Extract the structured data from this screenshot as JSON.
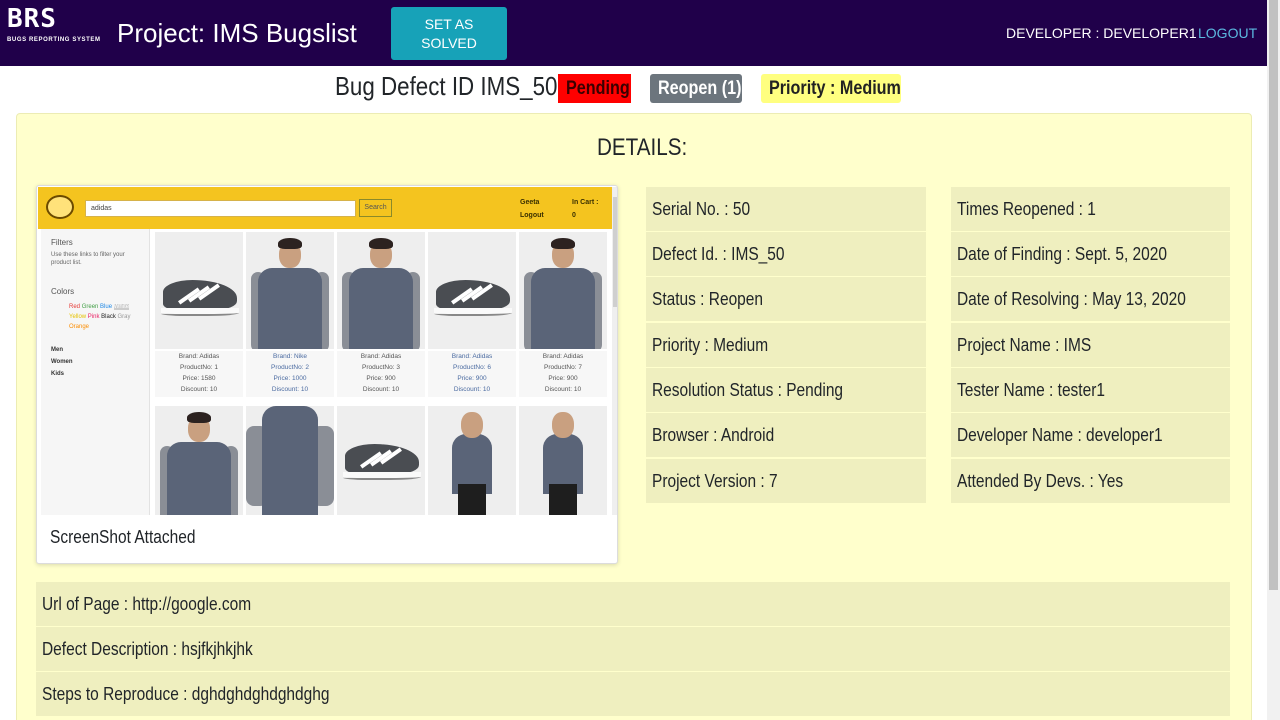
{
  "header": {
    "brand": "BRS",
    "brand_sub": "BUGS REPORTING SYSTEM",
    "project_title": "Project: IMS Bugslist",
    "solve_button": "SET AS SOLVED",
    "developer_label": "DEVELOPER : DEVELOPER1",
    "logout": "LOGOUT"
  },
  "bug": {
    "title": "Bug Defect ID IMS_50",
    "badge_status": "Pending",
    "badge_reopen": "Reopen (1)",
    "badge_priority": "Priority : Medium"
  },
  "details": {
    "heading": "DETAILS:",
    "screenshot_caption": "ScreenShot Attached",
    "left_fields": [
      "Serial No. : 50",
      "Defect Id. : IMS_50",
      "Status : Reopen",
      "Priority : Medium",
      "Resolution Status : Pending",
      "Browser : Android",
      "Project Version : 7"
    ],
    "right_fields": [
      "Times Reopened : 1",
      "Date of Finding : Sept. 5, 2020",
      "Date of Resolving : May 13, 2020",
      "Project Name : IMS",
      "Tester Name : tester1",
      "Developer Name : developer1",
      "Attended By Devs. : Yes"
    ],
    "full_fields": [
      "Url of Page : http://google.com",
      "Defect Description : hsjfkjhkjhk",
      "Steps to Reproduce : dghdghdghdghdghg"
    ]
  },
  "screenshot": {
    "search_value": "adidas",
    "search_button": "Search",
    "user_name": "Geeta",
    "user_logout": "Logout",
    "cart_label": "In Cart :",
    "cart_count": "0",
    "filters_title": "Filters",
    "filters_hint": "Use these links to filter your product list.",
    "colors_title": "Colors",
    "colors": [
      "Red",
      "Green",
      "Blue",
      "White",
      "Yellow",
      "Pink",
      "Black",
      "Gray",
      "Orange"
    ],
    "categories": [
      "Men",
      "Women",
      "Kids"
    ],
    "products": [
      {
        "brand": "Brand: Adidas",
        "product": "ProductNo: 1",
        "price": "Price: 1580",
        "discount": "Discount: 10"
      },
      {
        "brand": "Brand: Nike",
        "product": "ProductNo: 2",
        "price": "Price: 1000",
        "discount": "Discount: 10"
      },
      {
        "brand": "Brand: Adidas",
        "product": "ProductNo: 3",
        "price": "Price: 900",
        "discount": "Discount: 10"
      },
      {
        "brand": "Brand: Adidas",
        "product": "ProductNo: 6",
        "price": "Price: 900",
        "discount": "Discount: 10"
      },
      {
        "brand": "Brand: Adidas",
        "product": "ProductNo: 7",
        "price": "Price: 900",
        "discount": "Discount: 10"
      }
    ]
  },
  "colors": {
    "navbar": "#20004a",
    "solve_button": "#17a2b8",
    "logout_link": "#5bb8e0",
    "panel": "#ffffcc",
    "field_row": "#efefbf",
    "badge_pending": "#ff0000",
    "badge_reopen": "#6c757d",
    "badge_priority": "#ffff80"
  }
}
